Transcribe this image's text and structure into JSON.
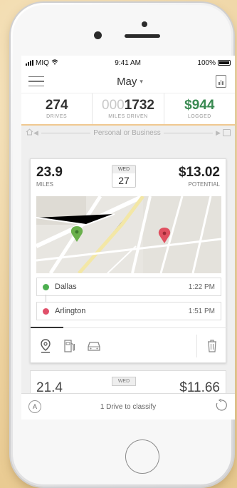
{
  "status_bar": {
    "carrier": "MIQ",
    "time": "9:41 AM",
    "battery": "100%"
  },
  "header": {
    "month": "May",
    "caret": "▾"
  },
  "stats": [
    {
      "value": "274",
      "label": "DRIVES"
    },
    {
      "value_dim": "000",
      "value": "1732",
      "label": "MILES DRIVEN"
    },
    {
      "value": "$944",
      "label": "LOGGED"
    }
  ],
  "classify_bar": {
    "label": "Personal or Business"
  },
  "drive_card": {
    "miles": "23.9",
    "miles_label": "MILES",
    "day_of_week": "WED",
    "day": "27",
    "potential": "$13.02",
    "potential_label": "POTENTIAL",
    "start": {
      "name": "Dallas",
      "time": "1:22 PM",
      "color": "#4caf50"
    },
    "end": {
      "name": "Arlington",
      "time": "1:51 PM",
      "color": "#e0506a"
    }
  },
  "next_card": {
    "miles": "21.4",
    "day_of_week": "WED",
    "potential": "$11.66"
  },
  "bottom_bar": {
    "avatar_letter": "A",
    "text": "1 Drive to classify"
  },
  "colors": {
    "green": "#3a8a52",
    "pin_green": "#6ab04c",
    "pin_red": "#e05060",
    "accent_line": "#f0c890"
  }
}
